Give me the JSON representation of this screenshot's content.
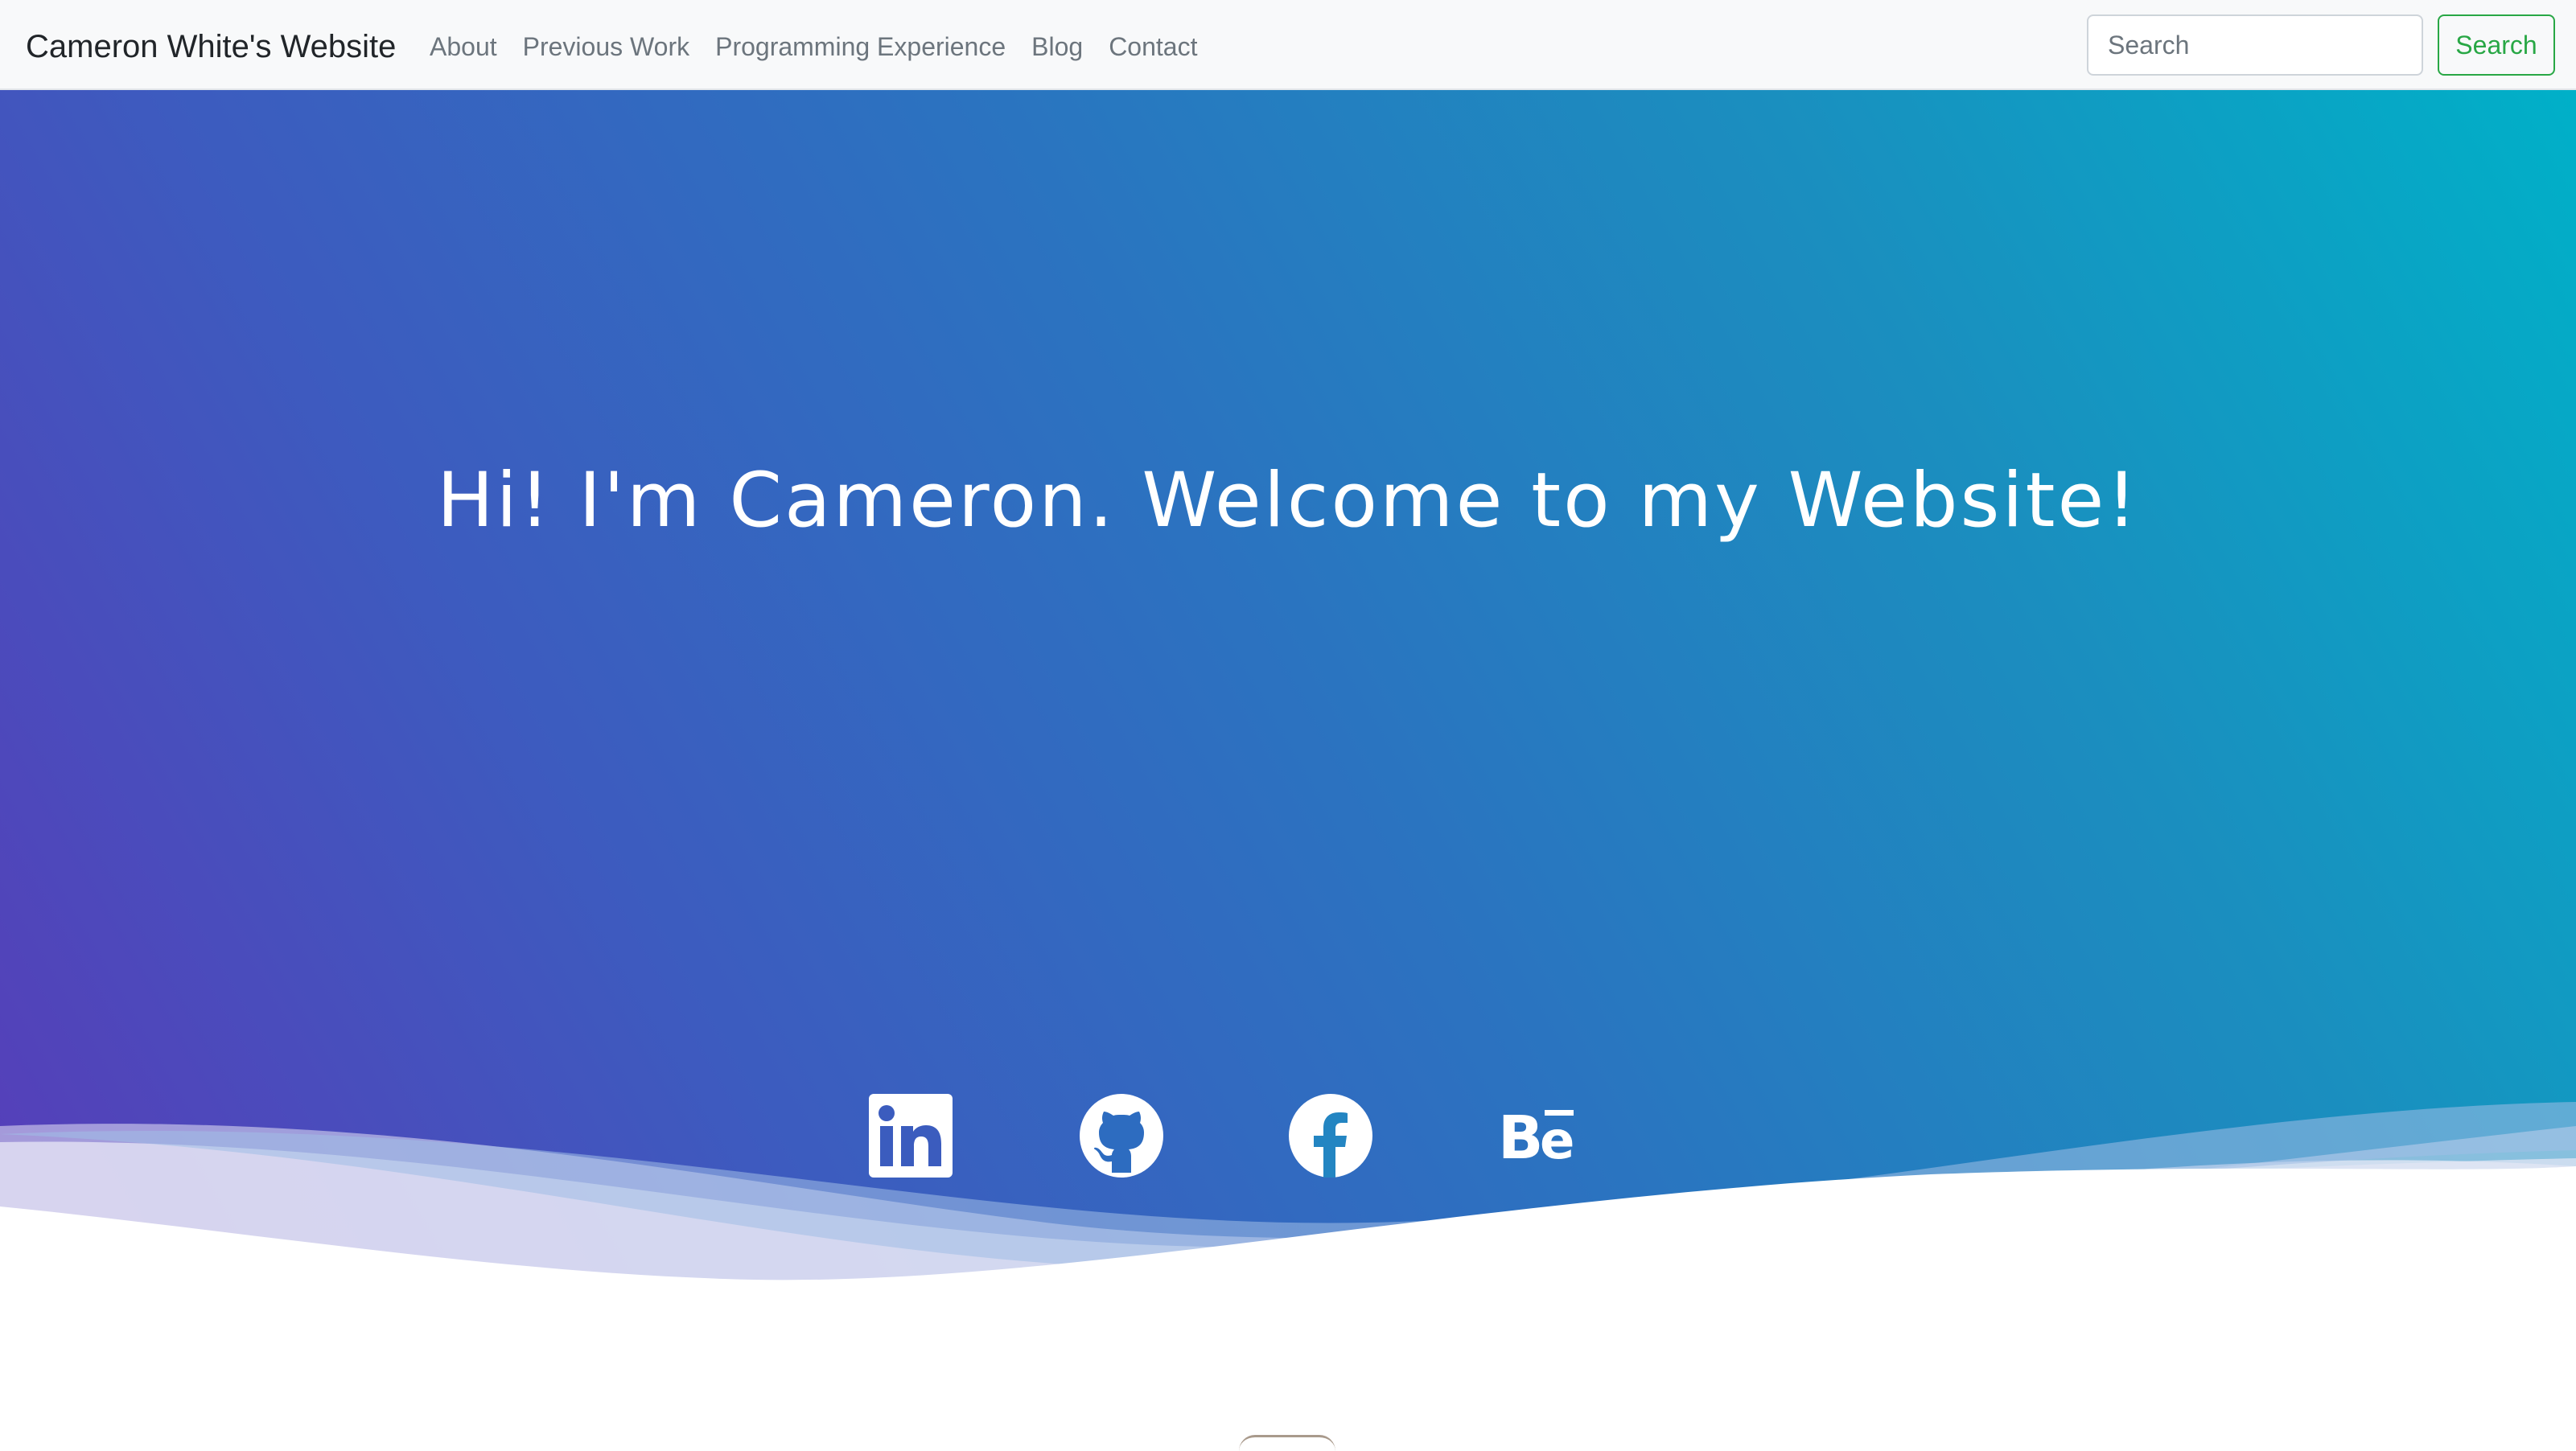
{
  "navbar": {
    "brand": "Cameron White's Website",
    "links": [
      {
        "label": "About"
      },
      {
        "label": "Previous Work"
      },
      {
        "label": "Programming Experience"
      },
      {
        "label": "Blog"
      },
      {
        "label": "Contact"
      }
    ],
    "search": {
      "placeholder": "Search",
      "value": "",
      "button_label": "Search"
    }
  },
  "hero": {
    "title": "Hi! I'm Cameron. Welcome to my Website!",
    "social": [
      {
        "icon": "linkedin-icon"
      },
      {
        "icon": "github-icon"
      },
      {
        "icon": "facebook-icon"
      },
      {
        "icon": "behance-icon"
      }
    ]
  },
  "colors": {
    "accent_green": "#28a745",
    "gradient_start": "#5a3ab8",
    "gradient_end": "#00b0c8",
    "navbar_bg": "#f8f9fa"
  }
}
